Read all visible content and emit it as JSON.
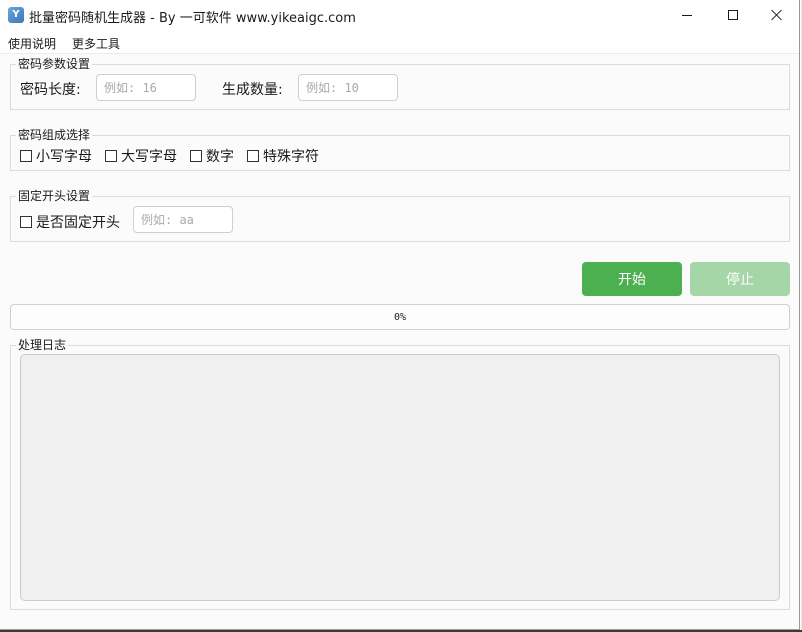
{
  "window": {
    "title": "批量密码随机生成器 - By 一可软件 www.yikeaigc.com",
    "icon": "app-icon"
  },
  "menu": {
    "help": "使用说明",
    "more_tools": "更多工具"
  },
  "password_settings": {
    "legend": "密码参数设置",
    "length_label": "密码长度:",
    "length_placeholder": "例如: 16",
    "count_label": "生成数量:",
    "count_placeholder": "例如: 10"
  },
  "composition": {
    "legend": "密码组成选择",
    "options": [
      {
        "label": "小写字母",
        "checked": false
      },
      {
        "label": "大写字母",
        "checked": false
      },
      {
        "label": "数字",
        "checked": false
      },
      {
        "label": "特殊字符",
        "checked": false
      }
    ]
  },
  "prefix": {
    "legend": "固定开头设置",
    "checkbox_label": "是否固定开头",
    "checked": false,
    "placeholder": "例如: aa"
  },
  "actions": {
    "start_label": "开始",
    "stop_label": "停止",
    "start_color": "#4caf50",
    "stop_color": "#a5d6a7"
  },
  "progress": {
    "value": 0,
    "text": "0%"
  },
  "log": {
    "legend": "处理日志",
    "content": ""
  }
}
